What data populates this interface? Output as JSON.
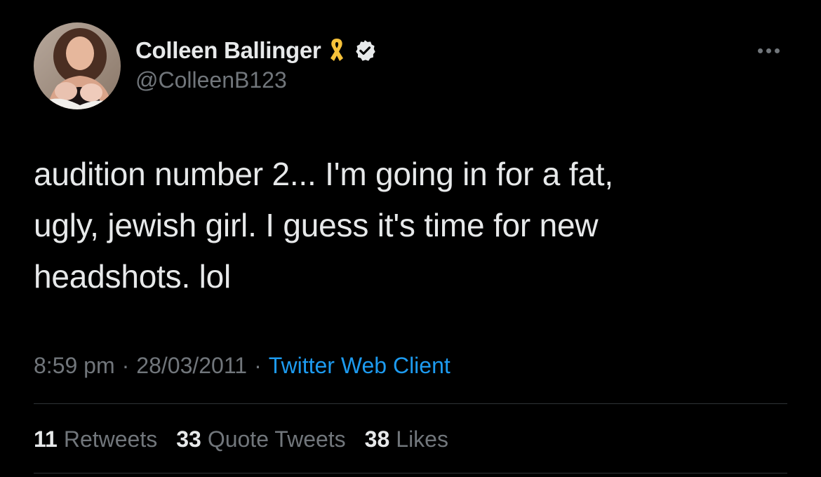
{
  "author": {
    "display_name": "Colleen Ballinger",
    "handle": "@ColleenB123",
    "avatar_icon": "profile-photo-avatar",
    "ribbon_icon": "yellow-awareness-ribbon-icon",
    "verified_icon": "verified-badge-icon"
  },
  "tweet": {
    "text": "audition number 2... I'm going in for a fat,\nugly, jewish girl.  I guess it's time for new\nheadshots. lol",
    "time": "8:59 pm",
    "separator": "·",
    "date": "28/03/2011",
    "source": "Twitter Web Client"
  },
  "stats": {
    "retweets_count": "11",
    "retweets_label": "Retweets",
    "quotes_count": "33",
    "quotes_label": "Quote Tweets",
    "likes_count": "38",
    "likes_label": "Likes"
  },
  "colors": {
    "background": "#000000",
    "primary_text": "#e7e9ea",
    "secondary_text": "#71767b",
    "link": "#1d9bf0",
    "ribbon": "#f7c23a",
    "divider": "#2f3336"
  }
}
